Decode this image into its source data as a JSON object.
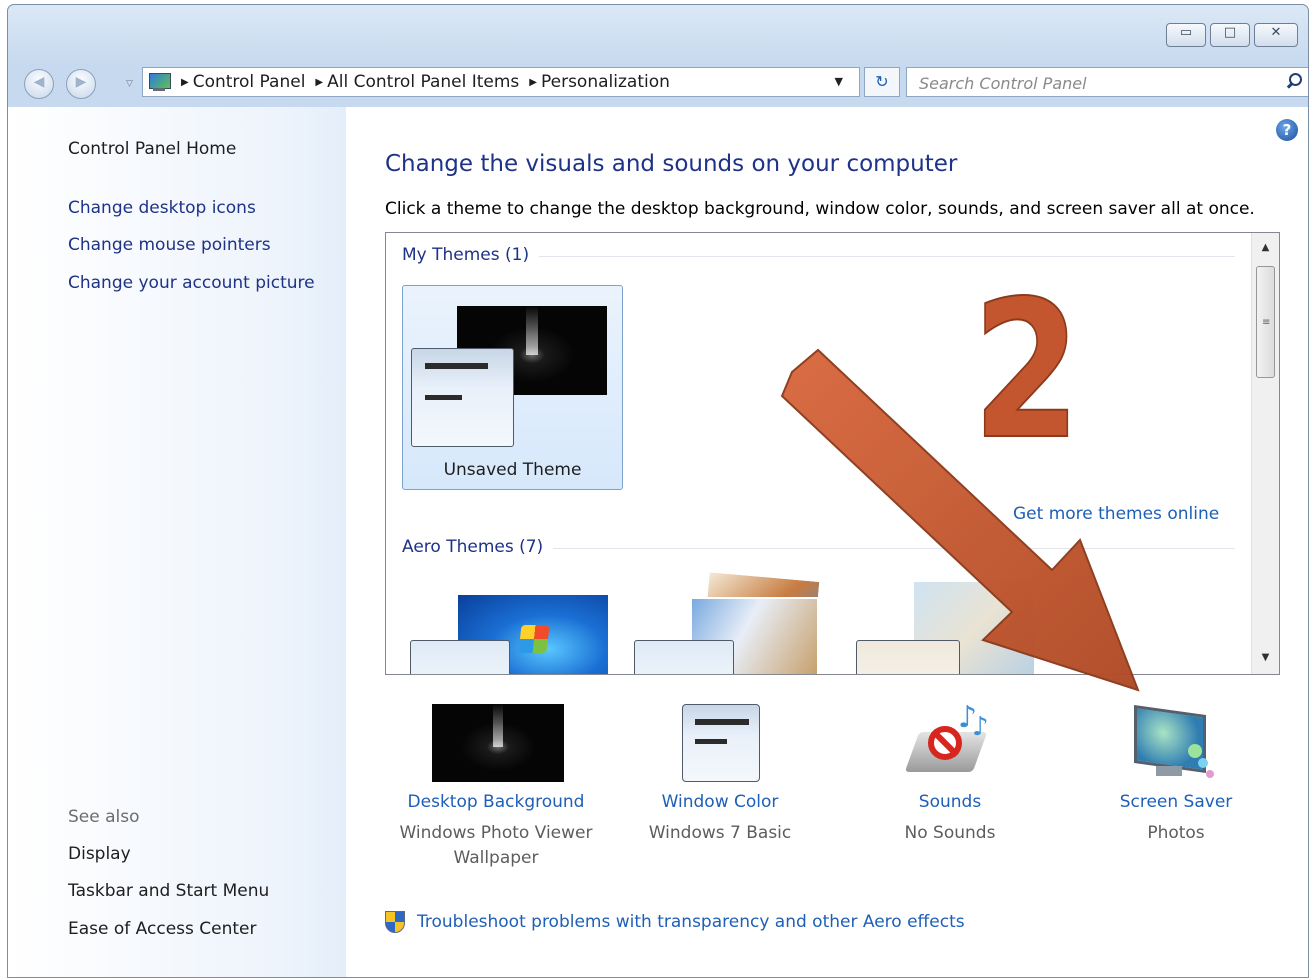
{
  "window": {
    "caption_buttons": {
      "minimize": "▭",
      "maximize": "□",
      "close": "✕"
    }
  },
  "address_bar": {
    "breadcrumbs": [
      "Control Panel",
      "All Control Panel Items",
      "Personalization"
    ],
    "search_placeholder": "Search Control Panel"
  },
  "left_pane": {
    "home_link": "Control Panel Home",
    "links": [
      "Change desktop icons",
      "Change mouse pointers",
      "Change your account picture"
    ],
    "see_also_label": "See also",
    "see_also": [
      "Display",
      "Taskbar and Start Menu",
      "Ease of Access Center"
    ]
  },
  "main": {
    "title": "Change the visuals and sounds on your computer",
    "description": "Click a theme to change the desktop background, window color, sounds, and screen saver all at once.",
    "themes": {
      "my_themes_label": "My Themes (1)",
      "my_themes": [
        {
          "name": "Unsaved Theme",
          "selected": true
        }
      ],
      "get_more_link": "Get more themes online",
      "aero_themes_label": "Aero Themes (7)"
    },
    "options": [
      {
        "id": "desktop-background",
        "label": "Desktop Background",
        "value_line1": "Windows Photo Viewer",
        "value_line2": "Wallpaper",
        "icon": "desktop-background-icon"
      },
      {
        "id": "window-color",
        "label": "Window Color",
        "value_line1": "Windows 7 Basic",
        "value_line2": "",
        "icon": "window-color-icon"
      },
      {
        "id": "sounds",
        "label": "Sounds",
        "value_line1": "No Sounds",
        "value_line2": "",
        "icon": "sounds-icon"
      },
      {
        "id": "screen-saver",
        "label": "Screen Saver",
        "value_line1": "Photos",
        "value_line2": "",
        "icon": "screen-saver-icon"
      }
    ],
    "troubleshoot_link": "Troubleshoot problems with transparency and other Aero effects"
  },
  "annotation": {
    "step_number": "2",
    "arrow_color": "#c4562f",
    "arrow_icon": "pointing-arrow-icon"
  }
}
